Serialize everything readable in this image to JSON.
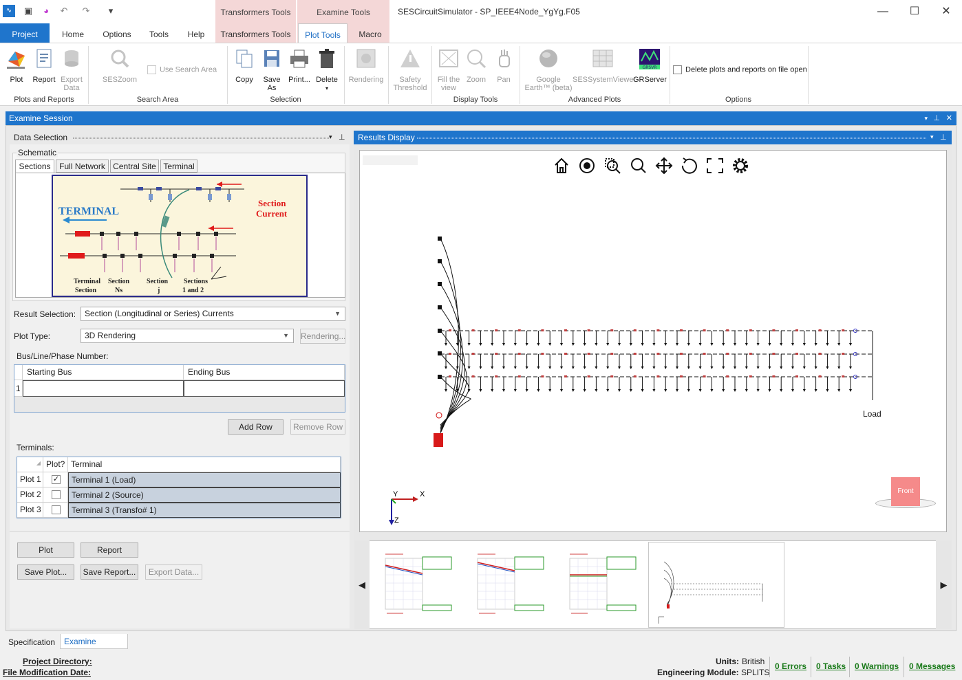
{
  "window": {
    "title": "SESCircuitSimulator - SP_IEEE4Node_YgYg.F05",
    "context_groups": [
      "Transformers Tools",
      "Examine Tools"
    ]
  },
  "tabs": [
    "Project",
    "Home",
    "Options",
    "Tools",
    "Help",
    "Transformers Tools",
    "Plot Tools",
    "Macro"
  ],
  "ribbon": {
    "plots_reports": {
      "label": "Plots and Reports",
      "plot": "Plot",
      "report": "Report",
      "export_data": "Export\nData"
    },
    "search_area": {
      "label": "Search Area",
      "seszoom": "SESZoom",
      "use_search_area": "Use Search Area"
    },
    "selection": {
      "label": "Selection",
      "copy": "Copy",
      "save_as": "Save\nAs",
      "print": "Print...",
      "delete": "Delete"
    },
    "rendering": "Rendering",
    "safety": "Safety\nThreshold",
    "display_tools": {
      "label": "Display Tools",
      "fill_view": "Fill the\nview",
      "zoom": "Zoom",
      "pan": "Pan"
    },
    "advanced_plots": {
      "label": "Advanced Plots",
      "google_earth": "Google\nEarth™ (beta)",
      "ses_viewer": "SESSystemViewer",
      "grserver": "GRServer",
      "grserver_logo_text": "GRSVR"
    },
    "options": {
      "label": "Options",
      "delete_plots": "Delete plots and reports on file open"
    }
  },
  "examine_session": {
    "title": "Examine Session",
    "data_selection": {
      "title": "Data Selection",
      "schematic_label": "Schematic",
      "schematic_tabs": [
        "Sections",
        "Full Network",
        "Central Site",
        "Terminal"
      ],
      "diagram": {
        "terminal": "TERMINAL",
        "section_current": [
          "Section",
          "Current"
        ],
        "bottom_labels": [
          "Terminal",
          "Section",
          "Section",
          "Section",
          "Sections"
        ],
        "bottom_labels2": [
          "Section",
          "Ns",
          "j",
          "1  and  2"
        ]
      },
      "result_selection_label": "Result Selection:",
      "result_selection_value": "Section (Longitudinal or Series) Currents",
      "plot_type_label": "Plot Type:",
      "plot_type_value": "3D Rendering",
      "rendering_btn": "Rendering...",
      "bus_label": "Bus/Line/Phase Number:",
      "bus_grid": {
        "headers": [
          "Starting Bus",
          "Ending Bus"
        ],
        "rows": [
          {
            "index": "1",
            "start": "",
            "end": ""
          }
        ]
      },
      "add_row": "Add Row",
      "remove_row": "Remove Row",
      "terminals_label": "Terminals:",
      "terminals_grid": {
        "headers": [
          "Plot?",
          "Terminal"
        ],
        "rows": [
          {
            "row": "Plot 1",
            "checked": true,
            "name": "Terminal 1 (Load)"
          },
          {
            "row": "Plot 2",
            "checked": false,
            "name": "Terminal 2 (Source)"
          },
          {
            "row": "Plot 3",
            "checked": false,
            "name": "Terminal 3 (Transfo#  1)"
          }
        ]
      },
      "buttons": {
        "plot": "Plot",
        "report": "Report",
        "save_plot": "Save Plot...",
        "save_report": "Save Report...",
        "export_data": "Export Data..."
      }
    },
    "results_display": {
      "title": "Results Display",
      "load_label": "Load",
      "axes": {
        "x": "X",
        "y": "Y",
        "z": "Z"
      },
      "front_label": "Front",
      "toolbar_icons": [
        "home-icon",
        "eye-icon",
        "zoom-box-icon",
        "magnifier-icon",
        "move-icon",
        "rotate-icon",
        "fullscreen-icon",
        "gear-icon"
      ]
    }
  },
  "bottom_tabs": [
    "Specification",
    "Examine Session"
  ],
  "status": {
    "project_directory": "Project Directory:",
    "file_mod_date": "File Modification Date:",
    "units_label": "Units:",
    "units_value": "British",
    "eng_module_label": "Engineering Module:",
    "eng_module_value": "SPLITS",
    "errors": "0 Errors",
    "tasks": "0 Tasks",
    "warnings": "0 Warnings",
    "messages": "0 Messages"
  },
  "colors": {
    "accent": "#1f75cc",
    "context_tab": "#f4d7d7",
    "link_green": "#1a7a1a"
  }
}
